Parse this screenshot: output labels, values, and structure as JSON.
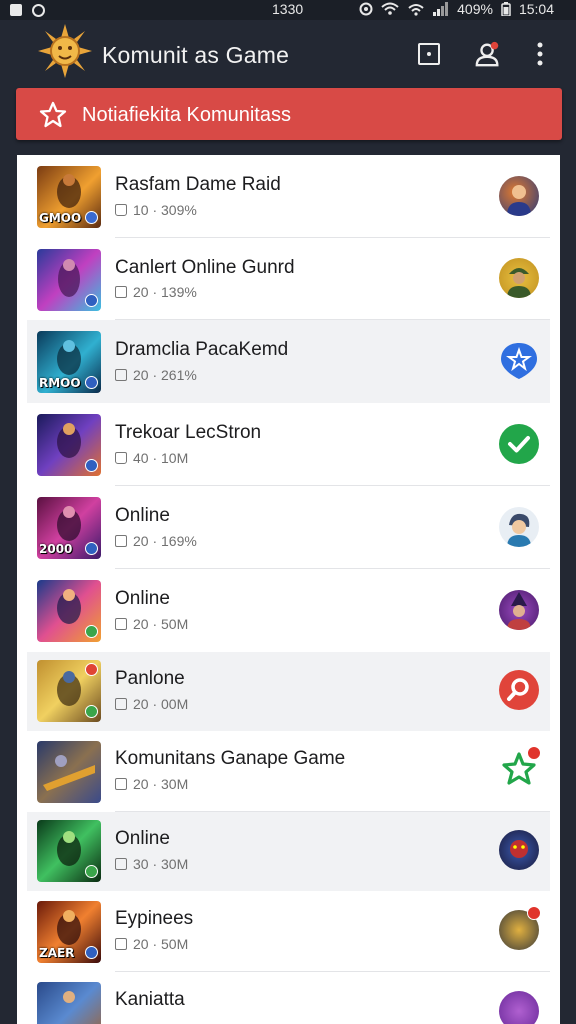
{
  "status_bar": {
    "center_time": "1330",
    "battery": "409%",
    "clock": "15:04"
  },
  "header": {
    "title": "Komunit as Game"
  },
  "banner": {
    "text": "Notiafiekita Komunitass"
  },
  "items": [
    {
      "title": "Rasfam Dame Raid",
      "meta": "10 · 309%",
      "meta_icon": "bag-icon",
      "thumb_text": "GMOO",
      "avatar": "warrior-avatar"
    },
    {
      "title": "Canlert Online Gunrd",
      "meta": "20 · 139%",
      "meta_icon": "checkbox-icon",
      "thumb_text": "",
      "avatar": "soldier-avatar"
    },
    {
      "title": "Dramclia PacaKemd",
      "meta": "20 · 261%",
      "meta_icon": "checkbox-icon",
      "thumb_text": "RMOO",
      "avatar": "map-pin-icon"
    },
    {
      "title": "Trekoar LecStron",
      "meta": "40 · 10M",
      "meta_icon": "bag-icon",
      "thumb_text": "",
      "avatar": "check-icon"
    },
    {
      "title": "Online",
      "meta": "20 · 169%",
      "meta_icon": "checkbox-icon",
      "thumb_text": "2000",
      "avatar": "hero-avatar"
    },
    {
      "title": "Online",
      "meta": "20 · 50M",
      "meta_icon": "checkbox-icon",
      "thumb_text": "",
      "avatar": "mage-avatar"
    },
    {
      "title": "Panlone",
      "meta": "20 · 00M",
      "meta_icon": "checkbox-icon",
      "thumb_text": "",
      "avatar": "search-icon"
    },
    {
      "title": "Komunitans Ganape Game",
      "meta": "20 · 30M",
      "meta_icon": "checkbox-icon",
      "thumb_text": "",
      "avatar": "star-badge-icon"
    },
    {
      "title": "Online",
      "meta": "30 · 30M",
      "meta_icon": "checkbox-icon",
      "thumb_text": "",
      "avatar": "demon-avatar"
    },
    {
      "title": "Eypinees",
      "meta": "20 · 50M",
      "meta_icon": "checkbox-icon",
      "thumb_text": "ZAER",
      "avatar": "knight-avatar"
    },
    {
      "title": "Kaniatta",
      "meta": "",
      "meta_icon": "",
      "thumb_text": "",
      "avatar": "purple-avatar"
    }
  ],
  "colors": {
    "background": "#232833",
    "banner": "#d84a46",
    "card": "#ffffff",
    "row_alt": "#f1f2f4",
    "accent_blue": "#2f6fe0",
    "accent_green": "#22a64a",
    "accent_red": "#e0443a"
  }
}
